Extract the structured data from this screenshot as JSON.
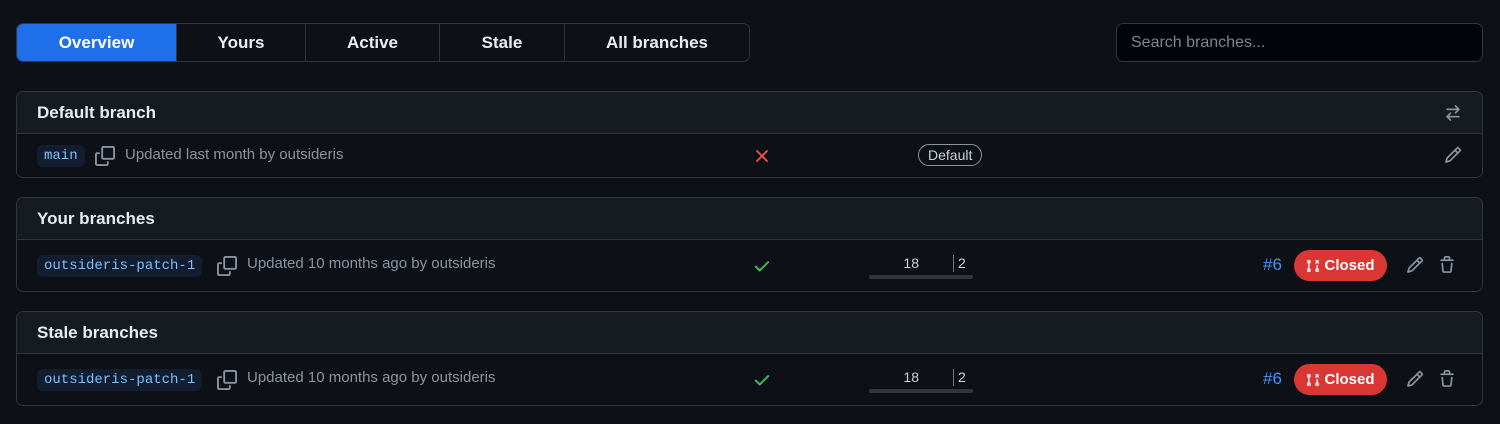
{
  "tabs": [
    {
      "label": "Overview",
      "active": true
    },
    {
      "label": "Yours",
      "active": false
    },
    {
      "label": "Active",
      "active": false
    },
    {
      "label": "Stale",
      "active": false
    },
    {
      "label": "All branches",
      "active": false
    }
  ],
  "search": {
    "placeholder": "Search branches..."
  },
  "default_section": {
    "title": "Default branch",
    "header_icon": "arrow-switch-icon",
    "branch": {
      "name": "main",
      "updated": "Updated last month by outsideris",
      "status": "failure",
      "badge": "Default"
    }
  },
  "your_section": {
    "title": "Your branches",
    "branch": {
      "name": "outsideris-patch-1",
      "updated": "Updated 10 months ago by outsideris",
      "status": "success",
      "behind": "18",
      "ahead": "2",
      "pr_number": "#6",
      "pr_state": "Closed"
    }
  },
  "stale_section": {
    "title": "Stale branches",
    "branch": {
      "name": "outsideris-patch-1",
      "updated": "Updated 10 months ago by outsideris",
      "status": "success",
      "behind": "18",
      "ahead": "2",
      "pr_number": "#6",
      "pr_state": "Closed"
    }
  },
  "colors": {
    "accent": "#1f6feb",
    "success": "#3fb950",
    "failure": "#f85149",
    "closed": "#da3633",
    "link": "#4493f8"
  }
}
